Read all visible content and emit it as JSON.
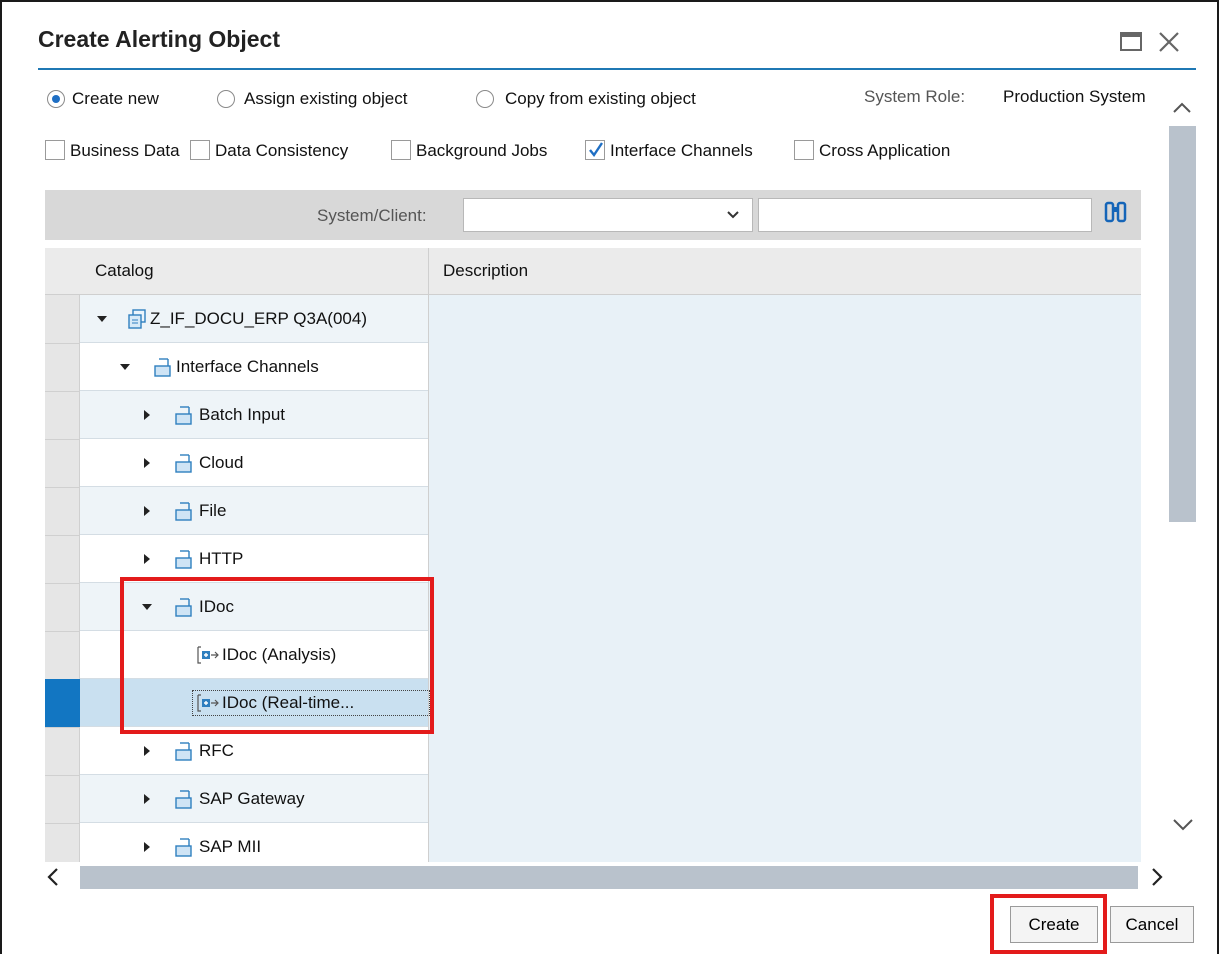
{
  "dialog": {
    "title": "Create Alerting Object"
  },
  "mode_options": [
    {
      "label": "Create new",
      "selected": true
    },
    {
      "label": "Assign existing object",
      "selected": false
    },
    {
      "label": "Copy from existing object",
      "selected": false
    }
  ],
  "system_role": {
    "label": "System Role:",
    "value": "Production System"
  },
  "categories": [
    {
      "label": "Business Data",
      "checked": false
    },
    {
      "label": "Data Consistency",
      "checked": false
    },
    {
      "label": "Background Jobs",
      "checked": false
    },
    {
      "label": "Interface Channels",
      "checked": true
    },
    {
      "label": "Cross Application",
      "checked": false
    }
  ],
  "filter": {
    "system_client_label": "System/Client:",
    "system_client_value": "",
    "search_value": ""
  },
  "table": {
    "columns": [
      "Catalog",
      "Description"
    ],
    "rows": [
      {
        "label": "Z_IF_DOCU_ERP Q3A(004)",
        "level": 0,
        "state": "expanded",
        "icon": "system-folder-icon"
      },
      {
        "label": "Interface Channels",
        "level": 1,
        "state": "expanded",
        "icon": "folder-icon"
      },
      {
        "label": "Batch Input",
        "level": 2,
        "state": "collapsed",
        "icon": "folder-icon"
      },
      {
        "label": "Cloud",
        "level": 2,
        "state": "collapsed",
        "icon": "folder-icon"
      },
      {
        "label": "File",
        "level": 2,
        "state": "collapsed",
        "icon": "folder-icon"
      },
      {
        "label": "HTTP",
        "level": 2,
        "state": "collapsed",
        "icon": "folder-icon"
      },
      {
        "label": "IDoc",
        "level": 2,
        "state": "expanded",
        "icon": "folder-icon"
      },
      {
        "label": "IDoc (Analysis)",
        "level": 3,
        "state": "leaf",
        "icon": "template-icon"
      },
      {
        "label": "IDoc (Real-time...",
        "level": 3,
        "state": "leaf",
        "icon": "template-icon",
        "selected": true
      },
      {
        "label": "RFC",
        "level": 2,
        "state": "collapsed",
        "icon": "folder-icon"
      },
      {
        "label": "SAP Gateway",
        "level": 2,
        "state": "collapsed",
        "icon": "folder-icon"
      },
      {
        "label": "SAP MII",
        "level": 2,
        "state": "collapsed",
        "icon": "folder-icon"
      }
    ]
  },
  "buttons": {
    "create": "Create",
    "cancel": "Cancel"
  },
  "colors": {
    "accent": "#1f78b4",
    "selection": "#1276c2",
    "highlight": "#e31b1b"
  }
}
